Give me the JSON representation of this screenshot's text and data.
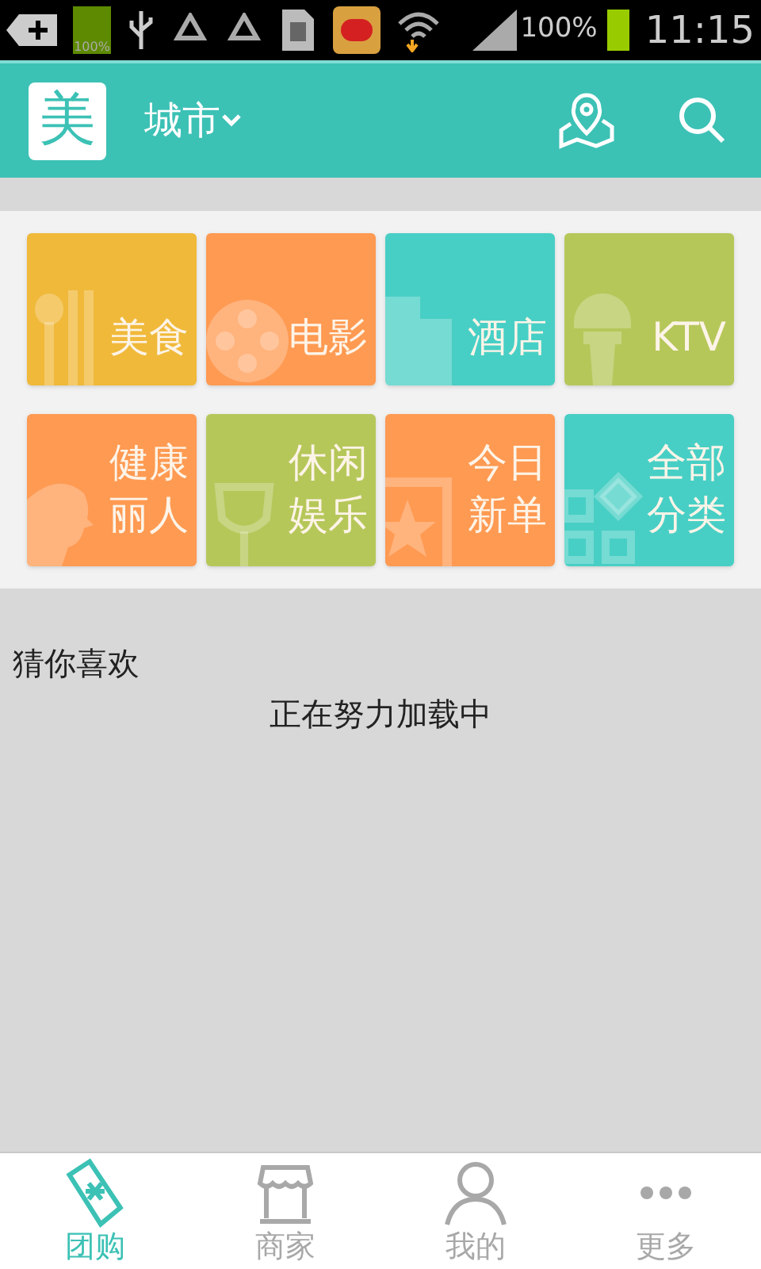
{
  "status_bar": {
    "battery_badge": "100%",
    "battery": "100%",
    "time": "11:15"
  },
  "header": {
    "logo": "美",
    "city": "城市"
  },
  "categories": [
    {
      "lines": [
        "美食"
      ],
      "color": "#f0b93a"
    },
    {
      "lines": [
        "电影"
      ],
      "color": "#ff9a52"
    },
    {
      "lines": [
        "酒店"
      ],
      "color": "#48cfc5"
    },
    {
      "lines": [
        "KTV"
      ],
      "color": "#b6c75a"
    },
    {
      "lines": [
        "健康",
        "丽人"
      ],
      "color": "#ff9a52"
    },
    {
      "lines": [
        "休闲",
        "娱乐"
      ],
      "color": "#b6c75a"
    },
    {
      "lines": [
        "今日",
        "新单"
      ],
      "color": "#ff9a52"
    },
    {
      "lines": [
        "全部",
        "分类"
      ],
      "color": "#48cfc5"
    }
  ],
  "recommend": {
    "title": "猜你喜欢",
    "loading": "正在努力加载中"
  },
  "tabs": [
    {
      "label": "团购",
      "selected": true
    },
    {
      "label": "商家",
      "selected": false
    },
    {
      "label": "我的",
      "selected": false
    },
    {
      "label": "更多",
      "selected": false
    }
  ]
}
